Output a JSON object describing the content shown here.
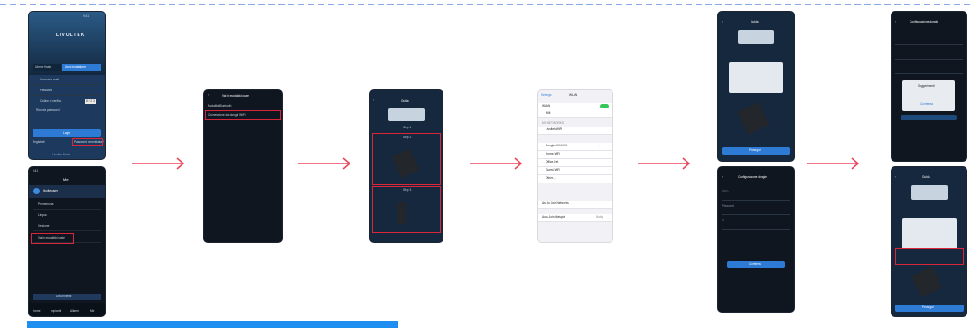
{
  "screens": {
    "login": {
      "status_time": "9:41",
      "brand": "LIVOLTEK",
      "tab_user": "Utente finale",
      "tab_installer": "Area installatore",
      "field_account": "Account o mail",
      "field_password": "Password",
      "field_captcha": "Codice di verifica",
      "captcha_value": "8 9 2 3",
      "remember": "Ricorda password",
      "login_button": "Login",
      "register_link": "Registrati",
      "forgot_link": "Password dimenticata?",
      "footer": "Livoltek Portal"
    },
    "me": {
      "status_time": "9:41",
      "title": "Me",
      "username": "livoltekuser",
      "item_1": "Promemoria",
      "item_2": "Lingua",
      "item_3": "Versione",
      "item_4": "Vai in modalità locale",
      "logout": "Disconnettiti",
      "tabs": [
        "Home",
        "Impianti",
        "Allarmi",
        "Me"
      ]
    },
    "local_mode": {
      "title": "Vai in modalità locale",
      "option_1": "Modalità Bluetooth",
      "option_2": "Connessione dal dongle WiFi"
    },
    "guide_1": {
      "title": "Guida",
      "step_1": "Step 1",
      "step_2": "Step 2",
      "step_3": "Step 3"
    },
    "wifi_settings": {
      "back": "Settings",
      "title": "WLAN",
      "wlan_label": "WLAN",
      "connected": "Wifi",
      "my_networks": "MY NETWORKS",
      "networks": [
        "Livoltek-WiFi",
        "Dongle-XXXXXX",
        "Home-WiFi",
        "Office-Net",
        "Guest-WiFi"
      ],
      "other": "Other...",
      "ask_join": "Ask to Join Networks",
      "auto_join": "Auto-Join Hotspot",
      "notify": "Notify"
    },
    "guide_2": {
      "title": "Guida",
      "next_button": "Prosegui"
    },
    "config_1": {
      "title": "Configurazione dongle",
      "field_1": "SSID",
      "field_2": "Password",
      "field_3": "IP",
      "button": "Conferma"
    },
    "config_2": {
      "title": "Configurazione dongle",
      "dialog_title": "Suggerimenti",
      "dialog_button": "Conferma"
    },
    "guide_3": {
      "title": "Guida",
      "next_button": "Prosegui"
    }
  },
  "colors": {
    "arrow": "#e8475a",
    "highlight": "#d9263a",
    "accent": "#2e7bd6",
    "screen_bg": "#0f1620"
  },
  "icons": [
    "arrow-right-icon",
    "back-icon",
    "user-icon",
    "wifi-icon",
    "toggle-icon"
  ]
}
